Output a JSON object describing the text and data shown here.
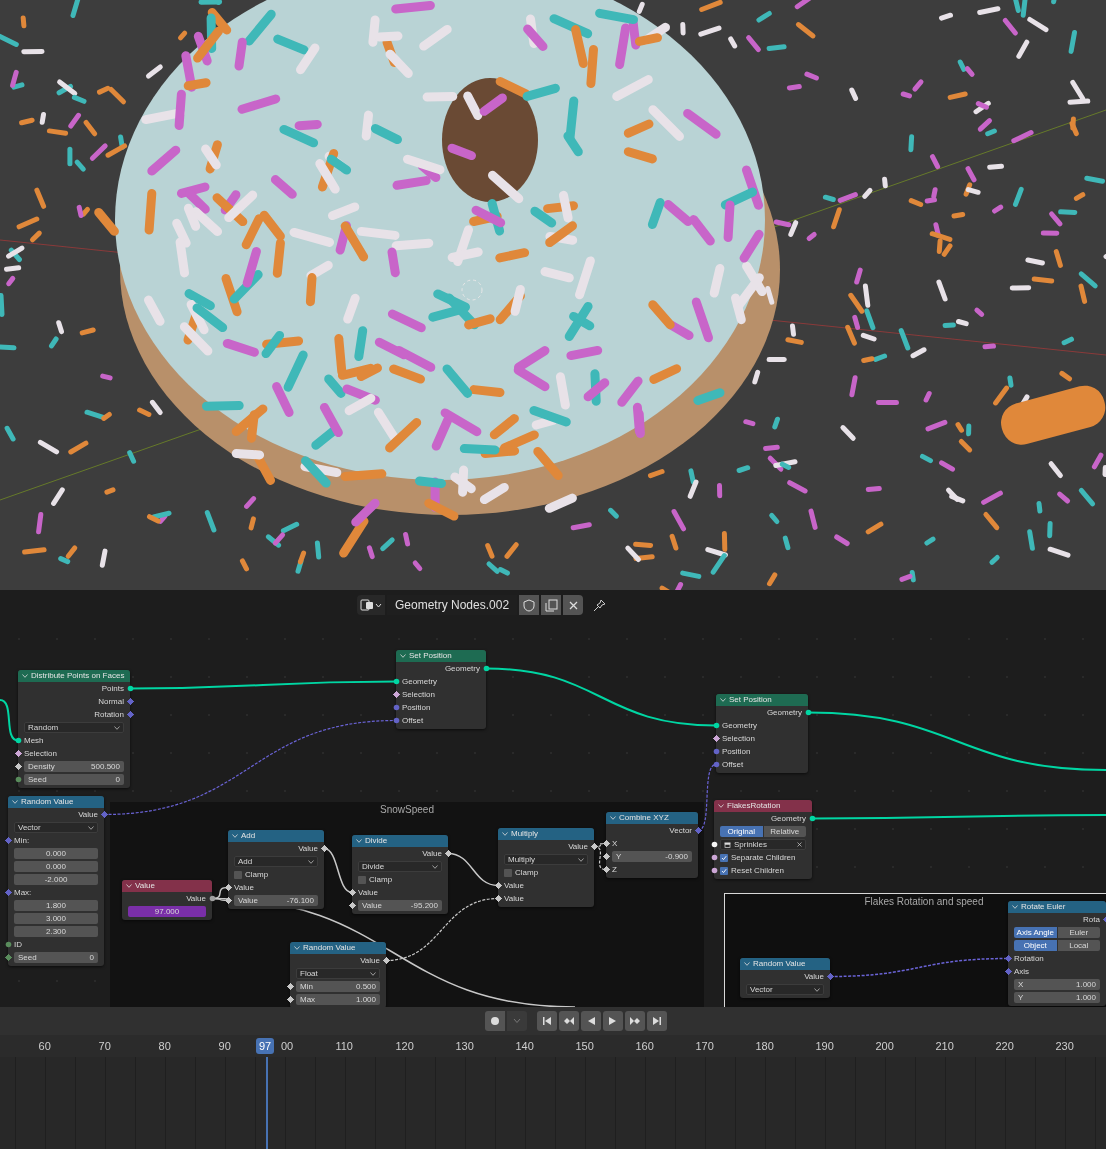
{
  "node_editor_header": {
    "datablock": "Geometry Nodes.002"
  },
  "frames": [
    {
      "label": "SnowSpeed"
    },
    {
      "label": "Flakes Rotation and speed"
    }
  ],
  "nodes": [
    {
      "title": "Distribute Points on Faces",
      "color": "#1e6b52",
      "rows": [
        {
          "kind": "out",
          "label": "Points",
          "socket": {
            "color": "#00d6a3",
            "field": false
          }
        },
        {
          "kind": "out",
          "label": "Normal",
          "socket": {
            "color": "#6363c7",
            "field": true
          }
        },
        {
          "kind": "out",
          "label": "Rotation",
          "socket": {
            "color": "#6363c7",
            "field": true
          }
        },
        {
          "kind": "dropdown",
          "value": "Random"
        },
        {
          "kind": "in",
          "label": "Mesh",
          "socket": {
            "color": "#00d6a3",
            "field": false
          }
        },
        {
          "kind": "in",
          "label": "Selection",
          "socket": {
            "color": "#cca6d6",
            "field": true
          }
        },
        {
          "kind": "field",
          "label": "Density",
          "value": "500.500",
          "socket": {
            "color": "#c8c8c8",
            "field": true
          }
        },
        {
          "kind": "field",
          "label": "Seed",
          "value": "0",
          "socket": {
            "color": "#598c5c",
            "field": false
          }
        }
      ]
    },
    {
      "title": "Random Value",
      "color": "#246283",
      "rows": [
        {
          "kind": "out",
          "label": "Value",
          "socket": {
            "color": "#6363c7",
            "field": true
          }
        },
        {
          "kind": "dropdown",
          "value": "Vector"
        },
        {
          "kind": "in",
          "label": "Min:",
          "socket": {
            "color": "#6363c7",
            "field": true
          }
        },
        {
          "kind": "field",
          "value": "0.000"
        },
        {
          "kind": "field",
          "value": "0.000"
        },
        {
          "kind": "field",
          "value": "-2.000"
        },
        {
          "kind": "in",
          "label": "Max:",
          "socket": {
            "color": "#6363c7",
            "field": true
          }
        },
        {
          "kind": "field",
          "value": "1.800"
        },
        {
          "kind": "field",
          "value": "3.000"
        },
        {
          "kind": "field",
          "value": "2.300"
        },
        {
          "kind": "in",
          "label": "ID",
          "socket": {
            "color": "#598c5c",
            "field": false
          }
        },
        {
          "kind": "field",
          "label": "Seed",
          "value": "0",
          "socket": {
            "color": "#598c5c",
            "field": true
          }
        }
      ]
    },
    {
      "title": "Set Position",
      "color": "#1e6b52",
      "rows": [
        {
          "kind": "out",
          "label": "Geometry",
          "socket": {
            "color": "#00d6a3",
            "field": false
          }
        },
        {
          "kind": "in",
          "label": "Geometry",
          "socket": {
            "color": "#00d6a3",
            "field": false
          }
        },
        {
          "kind": "in",
          "label": "Selection",
          "socket": {
            "color": "#cca6d6",
            "field": true
          }
        },
        {
          "kind": "in",
          "label": "Position",
          "socket": {
            "color": "#6363c7",
            "field": false
          }
        },
        {
          "kind": "in",
          "label": "Offset",
          "socket": {
            "color": "#6363c7",
            "field": false
          }
        }
      ]
    },
    {
      "title": "Value",
      "color": "#83314a",
      "rows": [
        {
          "kind": "out",
          "label": "Value",
          "socket": {
            "color": "#a1a1a1",
            "field": false
          }
        },
        {
          "kind": "value",
          "value": "97.000"
        }
      ]
    },
    {
      "title": "Add",
      "color": "#246283",
      "rows": [
        {
          "kind": "out",
          "label": "Value",
          "socket": {
            "color": "#c8c8c8",
            "field": true
          }
        },
        {
          "kind": "dropdown",
          "value": "Add"
        },
        {
          "kind": "checkbox",
          "label": "Clamp",
          "checked": false
        },
        {
          "kind": "in",
          "label": "Value",
          "socket": {
            "color": "#c8c8c8",
            "field": true
          }
        },
        {
          "kind": "field",
          "label": "Value",
          "value": "-76.100",
          "socket": {
            "color": "#c8c8c8",
            "field": true
          }
        }
      ]
    },
    {
      "title": "Divide",
      "color": "#246283",
      "rows": [
        {
          "kind": "out",
          "label": "Value",
          "socket": {
            "color": "#c8c8c8",
            "field": true
          }
        },
        {
          "kind": "dropdown",
          "value": "Divide"
        },
        {
          "kind": "checkbox",
          "label": "Clamp",
          "checked": false
        },
        {
          "kind": "in",
          "label": "Value",
          "socket": {
            "color": "#c8c8c8",
            "field": true
          }
        },
        {
          "kind": "field",
          "label": "Value",
          "value": "-95.200",
          "socket": {
            "color": "#c8c8c8",
            "field": true
          }
        }
      ]
    },
    {
      "title": "Random Value",
      "color": "#246283",
      "rows": [
        {
          "kind": "out",
          "label": "Value",
          "socket": {
            "color": "#c8c8c8",
            "field": true
          }
        },
        {
          "kind": "dropdown",
          "value": "Float"
        },
        {
          "kind": "field",
          "label": "Min",
          "value": "0.500",
          "socket": {
            "color": "#c8c8c8",
            "field": true
          }
        },
        {
          "kind": "field",
          "label": "Max",
          "value": "1.000",
          "socket": {
            "color": "#c8c8c8",
            "field": true
          }
        }
      ]
    },
    {
      "title": "Multiply",
      "color": "#246283",
      "rows": [
        {
          "kind": "out",
          "label": "Value",
          "socket": {
            "color": "#c8c8c8",
            "field": true
          }
        },
        {
          "kind": "dropdown",
          "value": "Multiply"
        },
        {
          "kind": "checkbox",
          "label": "Clamp",
          "checked": false
        },
        {
          "kind": "in",
          "label": "Value",
          "socket": {
            "color": "#c8c8c8",
            "field": true
          }
        },
        {
          "kind": "in",
          "label": "Value",
          "socket": {
            "color": "#c8c8c8",
            "field": true
          }
        }
      ]
    },
    {
      "title": "Combine XYZ",
      "color": "#246283",
      "rows": [
        {
          "kind": "out",
          "label": "Vector",
          "socket": {
            "color": "#6363c7",
            "field": true
          }
        },
        {
          "kind": "in",
          "label": "X",
          "socket": {
            "color": "#c8c8c8",
            "field": true
          }
        },
        {
          "kind": "field",
          "label": "Y",
          "value": "-0.900",
          "socket": {
            "color": "#c8c8c8",
            "field": true
          }
        },
        {
          "kind": "in",
          "label": "Z",
          "socket": {
            "color": "#c8c8c8",
            "field": true
          }
        }
      ]
    },
    {
      "title": "Set Position",
      "color": "#1e6b52",
      "rows": [
        {
          "kind": "out",
          "label": "Geometry",
          "socket": {
            "color": "#00d6a3",
            "field": false
          }
        },
        {
          "kind": "in",
          "label": "Geometry",
          "socket": {
            "color": "#00d6a3",
            "field": false
          }
        },
        {
          "kind": "in",
          "label": "Selection",
          "socket": {
            "color": "#cca6d6",
            "field": true
          }
        },
        {
          "kind": "in",
          "label": "Position",
          "socket": {
            "color": "#6363c7",
            "field": false
          }
        },
        {
          "kind": "in",
          "label": "Offset",
          "socket": {
            "color": "#6363c7",
            "field": false
          }
        }
      ]
    },
    {
      "title": "FlakesRotation",
      "color": "#83314a",
      "rows": [
        {
          "kind": "out",
          "label": "Geometry",
          "socket": {
            "color": "#00d6a3",
            "field": false
          }
        },
        {
          "kind": "toggle",
          "options": [
            {
              "label": "Original",
              "selected": true
            },
            {
              "label": "Relative",
              "selected": false
            }
          ]
        },
        {
          "kind": "object",
          "value": "Sprinkles",
          "socket": {
            "color": "#f5f5f5",
            "field": false
          }
        },
        {
          "kind": "checkbox",
          "label": "Separate Children",
          "checked": true,
          "socket": {
            "color": "#cca6d6",
            "field": false
          }
        },
        {
          "kind": "checkbox",
          "label": "Reset Children",
          "checked": true,
          "socket": {
            "color": "#cca6d6",
            "field": false
          }
        }
      ]
    },
    {
      "title": "Random Value",
      "color": "#246283",
      "rows": [
        {
          "kind": "out",
          "label": "Value",
          "socket": {
            "color": "#6363c7",
            "field": true
          }
        },
        {
          "kind": "dropdown",
          "value": "Vector"
        }
      ]
    },
    {
      "title": "Rotate Euler",
      "color": "#246283",
      "rows": [
        {
          "kind": "out",
          "label": "Rota",
          "socket": {
            "color": "#6363c7",
            "field": true
          }
        },
        {
          "kind": "toggle",
          "options": [
            {
              "label": "Axis Angle",
              "selected": true
            },
            {
              "label": "Euler",
              "selected": false
            }
          ]
        },
        {
          "kind": "toggle",
          "options": [
            {
              "label": "Object",
              "selected": true
            },
            {
              "label": "Local",
              "selected": false
            }
          ]
        },
        {
          "kind": "in",
          "label": "Rotation",
          "socket": {
            "color": "#6363c7",
            "field": true
          }
        },
        {
          "kind": "in",
          "label": "Axis",
          "socket": {
            "color": "#6363c7",
            "field": true
          }
        },
        {
          "kind": "field",
          "label": "X",
          "value": "1.000"
        },
        {
          "kind": "field",
          "label": "Y",
          "value": "1.000"
        }
      ]
    }
  ],
  "timeline": {
    "current_frame": "97",
    "frames": [
      "60",
      "70",
      "80",
      "90",
      "00",
      "110",
      "120",
      "130",
      "140",
      "150",
      "160",
      "170",
      "180",
      "190",
      "200",
      "210",
      "220",
      "230"
    ]
  }
}
